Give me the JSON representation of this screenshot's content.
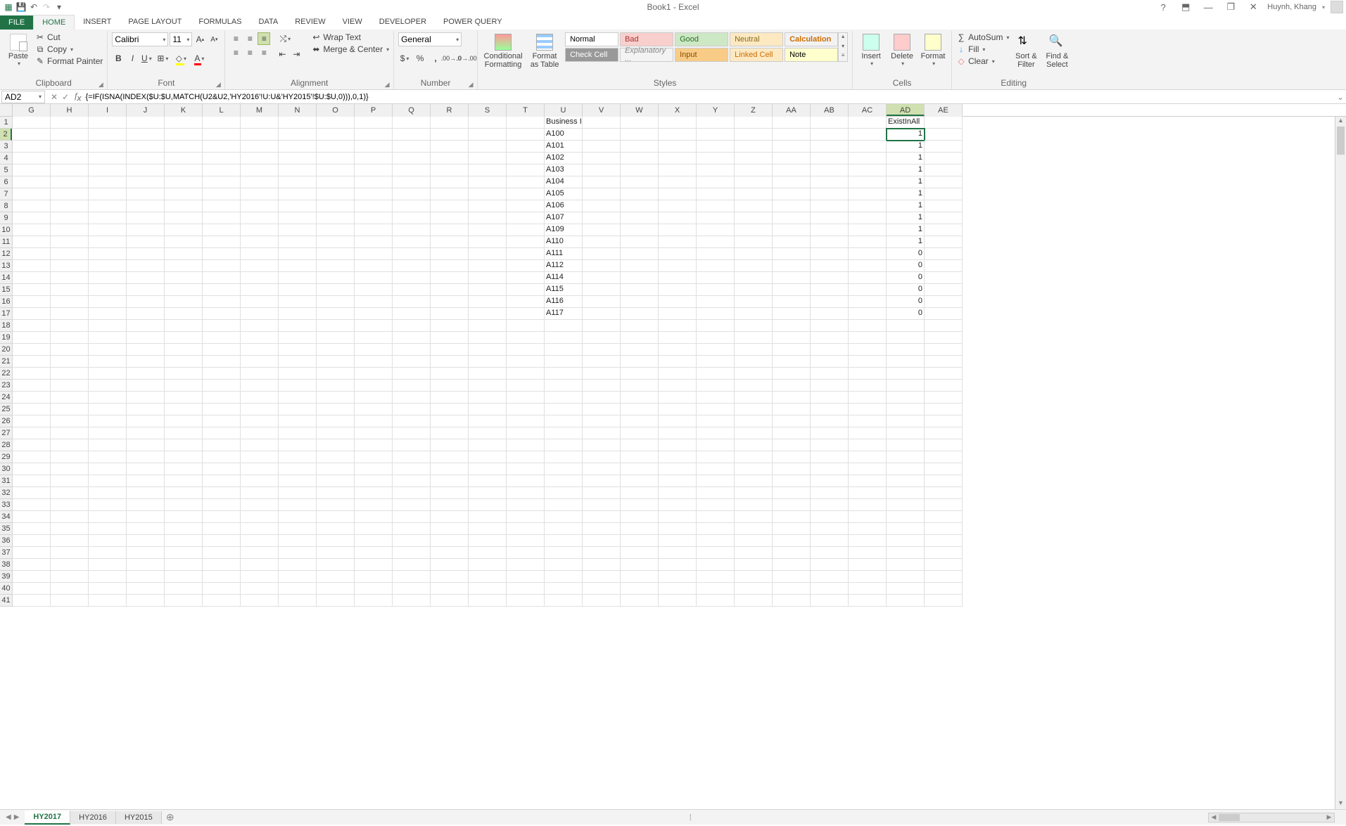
{
  "titlebar": {
    "title": "Book1 - Excel",
    "user": "Huynh, Khang"
  },
  "tabs": {
    "file": "FILE",
    "items": [
      "HOME",
      "INSERT",
      "PAGE LAYOUT",
      "FORMULAS",
      "DATA",
      "REVIEW",
      "VIEW",
      "DEVELOPER",
      "POWER QUERY"
    ],
    "activeIndex": 0
  },
  "ribbon": {
    "clipboard": {
      "paste": "Paste",
      "cut": "Cut",
      "copy": "Copy",
      "format_painter": "Format Painter",
      "label": "Clipboard"
    },
    "font": {
      "name": "Calibri",
      "size": "11",
      "label": "Font"
    },
    "alignment": {
      "wrap": "Wrap Text",
      "merge": "Merge & Center",
      "label": "Alignment"
    },
    "number": {
      "format": "General",
      "label": "Number"
    },
    "styles": {
      "conditional": "Conditional Formatting",
      "table": "Format as Table",
      "gallery": [
        "Normal",
        "Bad",
        "Good",
        "Neutral",
        "Calculation",
        "Check Cell",
        "Explanatory ...",
        "Input",
        "Linked Cell",
        "Note"
      ],
      "label": "Styles"
    },
    "cells": {
      "insert": "Insert",
      "delete": "Delete",
      "format": "Format",
      "label": "Cells"
    },
    "editing": {
      "autosum": "AutoSum",
      "fill": "Fill",
      "clear": "Clear",
      "sort": "Sort & Filter",
      "find": "Find & Select",
      "label": "Editing"
    }
  },
  "formulabar": {
    "namebox": "AD2",
    "formula": "{=IF(ISNA(INDEX($U:$U,MATCH(U2&U2,'HY2016'!U:U&'HY2015'!$U:$U,0))),0,1)}"
  },
  "grid": {
    "columns": [
      "G",
      "H",
      "I",
      "J",
      "K",
      "L",
      "M",
      "N",
      "O",
      "P",
      "Q",
      "R",
      "S",
      "T",
      "U",
      "V",
      "W",
      "X",
      "Y",
      "Z",
      "AA",
      "AB",
      "AC",
      "AD",
      "AE"
    ],
    "selectedCell": "AD2",
    "rowCount": 41,
    "headers": {
      "U": "Business ID",
      "AD": "ExistInAll"
    },
    "rows": [
      {
        "U": "A100",
        "AD": "1"
      },
      {
        "U": "A101",
        "AD": "1"
      },
      {
        "U": "A102",
        "AD": "1"
      },
      {
        "U": "A103",
        "AD": "1"
      },
      {
        "U": "A104",
        "AD": "1"
      },
      {
        "U": "A105",
        "AD": "1"
      },
      {
        "U": "A106",
        "AD": "1"
      },
      {
        "U": "A107",
        "AD": "1"
      },
      {
        "U": "A109",
        "AD": "1"
      },
      {
        "U": "A110",
        "AD": "1"
      },
      {
        "U": "A111",
        "AD": "0"
      },
      {
        "U": "A112",
        "AD": "0"
      },
      {
        "U": "A114",
        "AD": "0"
      },
      {
        "U": "A115",
        "AD": "0"
      },
      {
        "U": "A116",
        "AD": "0"
      },
      {
        "U": "A117",
        "AD": "0"
      }
    ]
  },
  "sheets": {
    "items": [
      "HY2017",
      "HY2016",
      "HY2015"
    ],
    "activeIndex": 0
  }
}
